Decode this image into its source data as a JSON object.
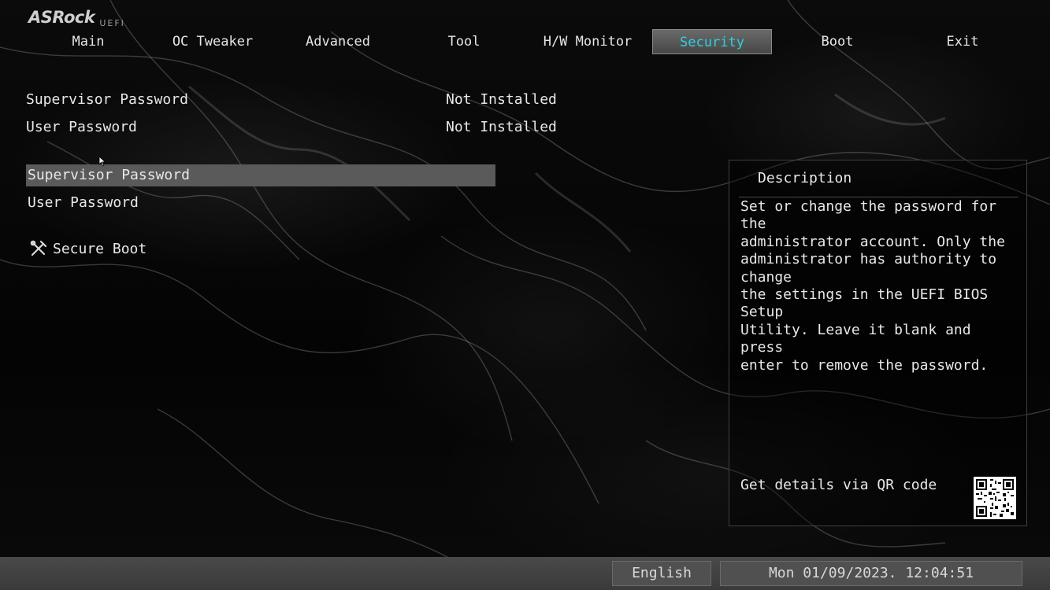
{
  "logo": {
    "brand": "ASRock",
    "sub": "UEFI"
  },
  "tabs": [
    {
      "label": "Main"
    },
    {
      "label": "OC Tweaker"
    },
    {
      "label": "Advanced"
    },
    {
      "label": "Tool"
    },
    {
      "label": "H/W Monitor"
    },
    {
      "label": "Security",
      "active": true
    },
    {
      "label": "Boot"
    },
    {
      "label": "Exit"
    }
  ],
  "status": {
    "supervisor_label": "Supervisor Password",
    "supervisor_value": "Not Installed",
    "user_label": "User Password",
    "user_value": "Not Installed"
  },
  "menu": {
    "supervisor_password": "Supervisor Password",
    "user_password": "User Password",
    "secure_boot": "Secure Boot"
  },
  "description": {
    "title": "Description",
    "text": "Set or change the password for the\nadministrator account. Only the\nadministrator has authority to change\nthe settings in the UEFI BIOS Setup\nUtility. Leave it blank and press\nenter to remove the password.",
    "qr_label": "Get details via QR code"
  },
  "footer": {
    "language": "English",
    "datetime": "Mon 01/09/2023. 12:04:51"
  },
  "colors": {
    "active_tab_text": "#2fd0e0",
    "selected_row": "#5a5a5a"
  }
}
